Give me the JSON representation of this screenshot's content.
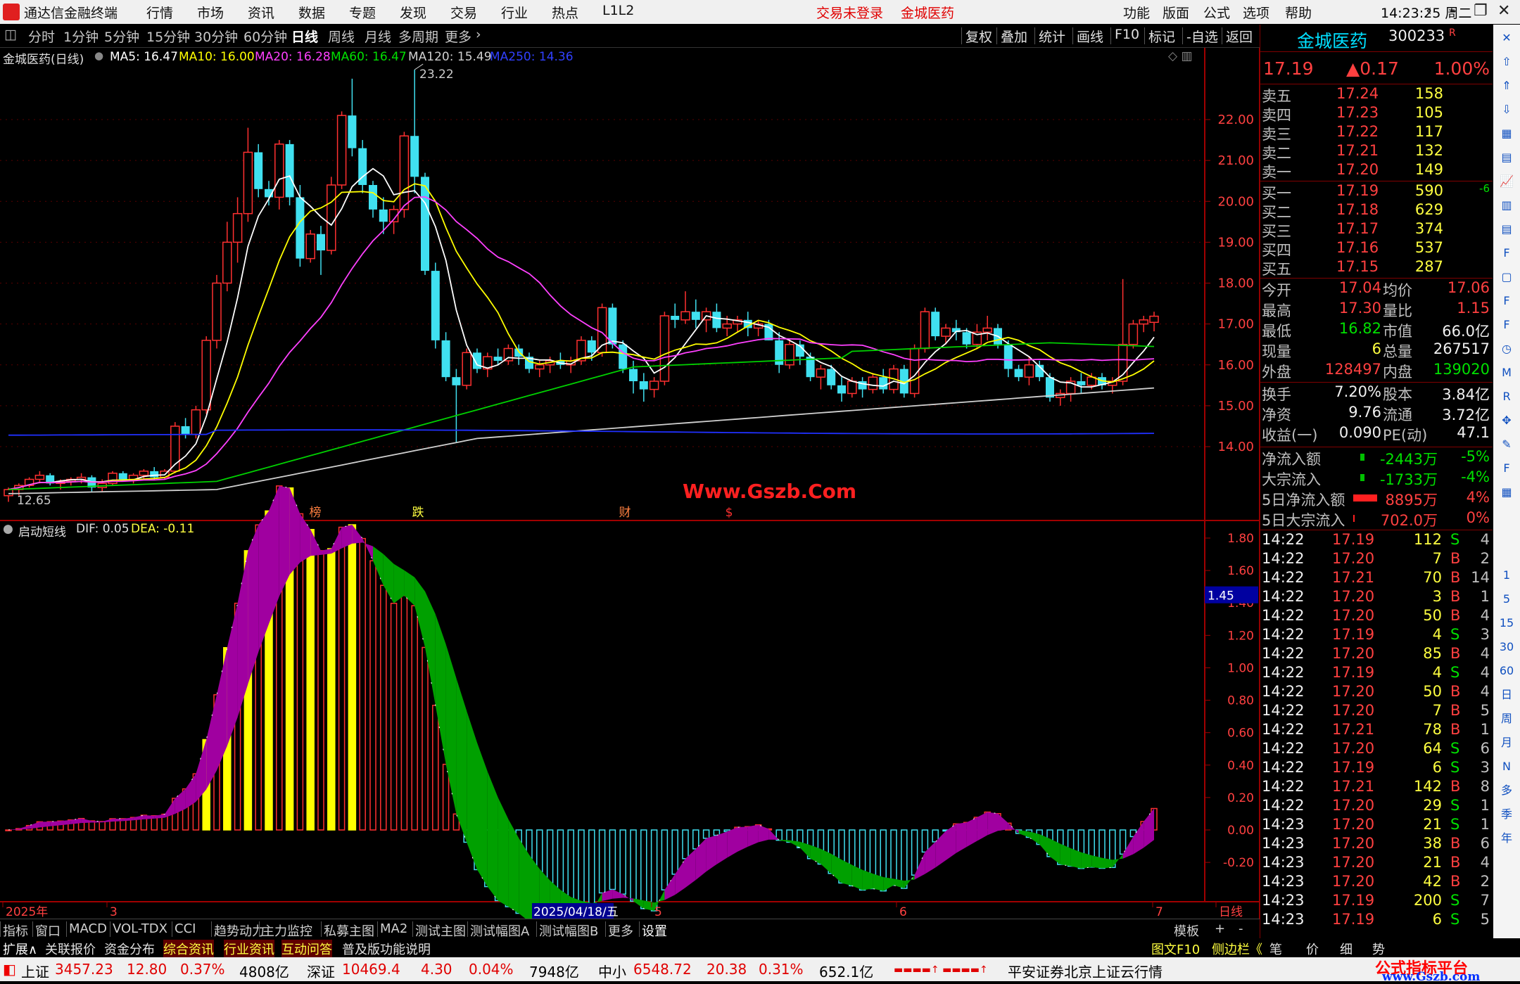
{
  "app": {
    "title": "通达信金融终端",
    "trade_status": "交易未登录",
    "stock_tab": "金城医药",
    "time": "14:23:25",
    "weekday": "周二"
  },
  "menu": [
    "行情",
    "市场",
    "资讯",
    "数据",
    "专题",
    "发现",
    "交易",
    "行业",
    "热点",
    "L1L2"
  ],
  "right_menu": [
    "功能",
    "版面",
    "公式",
    "选项",
    "帮助"
  ],
  "period_tabs": [
    "分时",
    "1分钟",
    "5分钟",
    "15分钟",
    "30分钟",
    "60分钟",
    "日线",
    "周线",
    "月线",
    "多周期",
    "更多"
  ],
  "active_period": "日线",
  "right_tools": [
    "复权",
    "叠加",
    "统计",
    "画线",
    "F10",
    "标记",
    "-自选",
    "返回"
  ],
  "main_header": {
    "name": "金城医药(日线)",
    "ma": [
      {
        "label": "MA5: 16.47",
        "color": "#ffffff"
      },
      {
        "label": "MA10: 16.00",
        "color": "#ffff00"
      },
      {
        "label": "MA20: 16.28",
        "color": "#ff40ff"
      },
      {
        "label": "MA60: 16.47",
        "color": "#00e000"
      },
      {
        "label": "MA120: 15.49",
        "color": "#d0d0d0"
      },
      {
        "label": "MA250: 14.36",
        "color": "#3040ff"
      }
    ],
    "high_mark": "23.22",
    "low_mark": "12.65",
    "watermark": "Www.Gszb.Com",
    "events": [
      "榜",
      "跌",
      "财",
      "$"
    ]
  },
  "price_axis": [
    "22.00",
    "21.00",
    "20.00",
    "19.00",
    "18.00",
    "17.00",
    "16.00",
    "15.00",
    "14.00"
  ],
  "sub_header": {
    "name": "启动短线",
    "dif": "DIF: 0.05",
    "dea": "DEA: -0.11"
  },
  "sub_axis": [
    "1.80",
    "1.60",
    "1.40",
    "1.20",
    "1.00",
    "0.80",
    "0.60",
    "0.40",
    "0.20",
    "0.00",
    "-0.20"
  ],
  "sub_marker": "1.45",
  "date_axis": {
    "year": "2025年",
    "m3": "3",
    "date_highlight": "2025/04/18/五",
    "m5": "5",
    "m6": "6",
    "m7": "7",
    "period": "日线"
  },
  "quote": {
    "name": "金城医药",
    "code": "300233",
    "flag": "R",
    "price": "17.19",
    "change": "▲0.17",
    "pct": "1.00%",
    "asks": [
      {
        "label": "卖五",
        "price": "17.24",
        "vol": "158"
      },
      {
        "label": "卖四",
        "price": "17.23",
        "vol": "105"
      },
      {
        "label": "卖三",
        "price": "17.22",
        "vol": "117"
      },
      {
        "label": "卖二",
        "price": "17.21",
        "vol": "132"
      },
      {
        "label": "卖一",
        "price": "17.20",
        "vol": "149"
      }
    ],
    "bids": [
      {
        "label": "买一",
        "price": "17.19",
        "vol": "590",
        "extra": "-6"
      },
      {
        "label": "买二",
        "price": "17.18",
        "vol": "629",
        "extra": ""
      },
      {
        "label": "买三",
        "price": "17.17",
        "vol": "374",
        "extra": ""
      },
      {
        "label": "买四",
        "price": "17.16",
        "vol": "537",
        "extra": ""
      },
      {
        "label": "买五",
        "price": "17.15",
        "vol": "287",
        "extra": ""
      }
    ],
    "stats": [
      {
        "l1": "今开",
        "v1": "17.04",
        "c1": "red",
        "l2": "均价",
        "v2": "17.06",
        "c2": "red"
      },
      {
        "l1": "最高",
        "v1": "17.30",
        "c1": "red",
        "l2": "量比",
        "v2": "1.15",
        "c2": "red"
      },
      {
        "l1": "最低",
        "v1": "16.82",
        "c1": "green",
        "l2": "市值",
        "v2": "66.0亿",
        "c2": "white"
      },
      {
        "l1": "现量",
        "v1": "6",
        "c1": "yellow",
        "l2": "总量",
        "v2": "267517",
        "c2": "white"
      },
      {
        "l1": "外盘",
        "v1": "128497",
        "c1": "red",
        "l2": "内盘",
        "v2": "139020",
        "c2": "green"
      }
    ],
    "stats2": [
      {
        "l1": "换手",
        "v1": "7.20%",
        "l2": "股本",
        "v2": "3.84亿"
      },
      {
        "l1": "净资",
        "v1": "9.76",
        "l2": "流通",
        "v2": "3.72亿"
      },
      {
        "l1": "收益(一)",
        "v1": "0.090",
        "l2": "PE(动)",
        "v2": "47.1"
      }
    ],
    "flows": [
      {
        "label": "净流入额",
        "value": "-2443万",
        "pct": "-5%",
        "color": "green"
      },
      {
        "label": "大宗流入",
        "value": "-1733万",
        "pct": "-4%",
        "color": "green"
      },
      {
        "label": "5日净流入额",
        "value": "8895万",
        "pct": "4%",
        "color": "red"
      },
      {
        "label": "5日大宗流入",
        "value": "702.0万",
        "pct": "0%",
        "color": "red"
      }
    ],
    "ticks": [
      [
        "14:22",
        "17.19",
        "112",
        "S",
        "4"
      ],
      [
        "14:22",
        "17.20",
        "7",
        "B",
        "2"
      ],
      [
        "14:22",
        "17.21",
        "70",
        "B",
        "14"
      ],
      [
        "14:22",
        "17.20",
        "3",
        "B",
        "1"
      ],
      [
        "14:22",
        "17.20",
        "50",
        "B",
        "4"
      ],
      [
        "14:22",
        "17.19",
        "4",
        "S",
        "3"
      ],
      [
        "14:22",
        "17.20",
        "85",
        "B",
        "4"
      ],
      [
        "14:22",
        "17.19",
        "4",
        "S",
        "4"
      ],
      [
        "14:22",
        "17.20",
        "50",
        "B",
        "4"
      ],
      [
        "14:22",
        "17.20",
        "7",
        "B",
        "5"
      ],
      [
        "14:22",
        "17.21",
        "78",
        "B",
        "1"
      ],
      [
        "14:22",
        "17.20",
        "64",
        "S",
        "6"
      ],
      [
        "14:22",
        "17.19",
        "6",
        "S",
        "3"
      ],
      [
        "14:22",
        "17.21",
        "142",
        "B",
        "8"
      ],
      [
        "14:22",
        "17.20",
        "29",
        "S",
        "1"
      ],
      [
        "14:23",
        "17.20",
        "21",
        "S",
        "1"
      ],
      [
        "14:23",
        "17.20",
        "38",
        "B",
        "6"
      ],
      [
        "14:23",
        "17.20",
        "21",
        "B",
        "4"
      ],
      [
        "14:23",
        "17.20",
        "42",
        "B",
        "2"
      ],
      [
        "14:23",
        "17.19",
        "200",
        "S",
        "7"
      ],
      [
        "14:23",
        "17.19",
        "6",
        "S",
        "5"
      ]
    ]
  },
  "bottom_tabs": [
    "指标",
    "窗口",
    "MACD",
    "VOL-TDX",
    "CCI",
    "趋势动力",
    "主力监控",
    "私募主图",
    "MA2",
    "测试主图",
    "测试幅图A",
    "测试幅图B",
    "更多",
    "设置"
  ],
  "bottom_right": [
    "模板",
    "+",
    "-"
  ],
  "bottom_tabs2": [
    "扩展∧",
    "关联报价",
    "资金分布",
    "综合资讯",
    "行业资讯",
    "互动问答",
    "普及版功能说明"
  ],
  "bottom_tabs2_right": [
    "图文F10",
    "侧边栏《",
    "笔",
    "价",
    "细",
    "势"
  ],
  "status": {
    "sh_label": "上证",
    "sh": "3457.23",
    "sh_chg": "12.80",
    "sh_pct": "0.37%",
    "sh_amt": "4808亿",
    "sz_label": "深证",
    "sz": "10469.4",
    "sz_chg": "4.30",
    "sz_pct": "0.04%",
    "sz_amt": "7948亿",
    "zx_label": "中小",
    "zx": "6548.72",
    "zx_chg": "20.38",
    "zx_pct": "0.31%",
    "zx_amt": "652.1亿",
    "server": "平安证券北京上证云行情",
    "brand1": "公式指标平台",
    "brand2": "www.Gszb.com"
  },
  "side_icons": [
    "close-icon",
    "up-icon",
    "up2-icon",
    "down-icon",
    "grid-icon",
    "table-icon",
    "chart-icon",
    "candle-icon",
    "list-icon",
    "f10-icon",
    "doc-icon",
    "f2-icon",
    "f-icon",
    "clock-icon",
    "macd-icon",
    "rsi-icon",
    "move-icon",
    "pen-icon",
    "fs-icon",
    "calc-icon"
  ],
  "side_labels": [
    "1",
    "5",
    "15",
    "30",
    "60",
    "日",
    "周",
    "月",
    "N",
    "多",
    "季",
    "年"
  ],
  "chart_data": {
    "type": "candlestick",
    "candles": [
      [
        12.8,
        13.0,
        12.65,
        12.95
      ],
      [
        12.95,
        13.1,
        12.8,
        13.05
      ],
      [
        13.05,
        13.25,
        13.0,
        13.2
      ],
      [
        13.2,
        13.4,
        13.1,
        13.3
      ],
      [
        13.3,
        13.35,
        13.05,
        13.1
      ],
      [
        13.1,
        13.2,
        12.95,
        13.15
      ],
      [
        13.15,
        13.25,
        13.05,
        13.2
      ],
      [
        13.2,
        13.35,
        13.1,
        13.25
      ],
      [
        13.25,
        13.3,
        12.9,
        13.0
      ],
      [
        13.0,
        13.2,
        12.9,
        13.1
      ],
      [
        13.1,
        13.4,
        13.05,
        13.35
      ],
      [
        13.35,
        13.4,
        13.15,
        13.2
      ],
      [
        13.2,
        13.35,
        13.1,
        13.3
      ],
      [
        13.3,
        13.45,
        13.2,
        13.4
      ],
      [
        13.4,
        13.5,
        13.2,
        13.25
      ],
      [
        13.25,
        13.45,
        13.2,
        13.4
      ],
      [
        13.4,
        14.6,
        13.35,
        14.5
      ],
      [
        14.5,
        14.7,
        14.2,
        14.3
      ],
      [
        14.3,
        15.0,
        14.2,
        14.9
      ],
      [
        14.9,
        16.7,
        14.8,
        16.6
      ],
      [
        16.6,
        18.2,
        16.4,
        18.0
      ],
      [
        18.0,
        19.5,
        17.8,
        19.0
      ],
      [
        19.0,
        20.1,
        18.5,
        19.7
      ],
      [
        19.7,
        21.8,
        19.5,
        21.2
      ],
      [
        21.2,
        21.4,
        20.1,
        20.3
      ],
      [
        20.3,
        20.5,
        19.9,
        20.1
      ],
      [
        20.1,
        21.5,
        19.8,
        21.4
      ],
      [
        21.4,
        21.5,
        19.9,
        20.1
      ],
      [
        20.1,
        20.4,
        18.4,
        18.6
      ],
      [
        18.6,
        19.3,
        18.5,
        19.2
      ],
      [
        19.2,
        19.4,
        18.2,
        18.8
      ],
      [
        18.8,
        20.6,
        18.7,
        20.4
      ],
      [
        20.4,
        22.2,
        20.3,
        22.1
      ],
      [
        22.1,
        23.0,
        21.1,
        21.3
      ],
      [
        21.3,
        21.5,
        20.2,
        20.4
      ],
      [
        20.4,
        20.5,
        19.6,
        19.8
      ],
      [
        19.8,
        20.1,
        19.2,
        19.5
      ],
      [
        19.5,
        19.9,
        19.2,
        19.8
      ],
      [
        19.8,
        21.7,
        19.6,
        21.6
      ],
      [
        21.6,
        23.22,
        20.2,
        20.6
      ],
      [
        20.6,
        20.7,
        18.2,
        18.3
      ],
      [
        18.3,
        18.5,
        16.4,
        16.6
      ],
      [
        16.6,
        16.8,
        15.6,
        15.7
      ],
      [
        15.7,
        15.9,
        14.1,
        15.5
      ],
      [
        15.5,
        16.4,
        15.4,
        16.3
      ],
      [
        16.3,
        16.4,
        15.8,
        15.9
      ],
      [
        15.9,
        16.3,
        15.7,
        16.2
      ],
      [
        16.2,
        16.4,
        16.0,
        16.1
      ],
      [
        16.1,
        16.5,
        16.0,
        16.4
      ],
      [
        16.4,
        16.5,
        16.0,
        16.2
      ],
      [
        16.2,
        16.3,
        15.8,
        15.9
      ],
      [
        15.9,
        16.1,
        15.7,
        16.0
      ],
      [
        16.0,
        16.2,
        15.8,
        16.1
      ],
      [
        16.1,
        16.3,
        15.9,
        16.0
      ],
      [
        16.0,
        16.2,
        15.8,
        16.1
      ],
      [
        16.1,
        16.7,
        16.0,
        16.6
      ],
      [
        16.6,
        16.7,
        16.1,
        16.3
      ],
      [
        16.3,
        17.5,
        16.2,
        17.4
      ],
      [
        17.4,
        17.5,
        16.4,
        16.5
      ],
      [
        16.5,
        16.6,
        15.8,
        15.9
      ],
      [
        15.9,
        16.1,
        15.3,
        15.6
      ],
      [
        15.6,
        15.8,
        15.1,
        15.4
      ],
      [
        15.4,
        15.7,
        15.2,
        15.6
      ],
      [
        15.6,
        17.3,
        15.5,
        17.2
      ],
      [
        17.2,
        17.5,
        16.9,
        17.1
      ],
      [
        17.1,
        17.8,
        17.0,
        17.3
      ],
      [
        17.3,
        17.6,
        16.9,
        17.1
      ],
      [
        17.1,
        17.4,
        16.8,
        17.3
      ],
      [
        17.3,
        17.5,
        16.8,
        16.9
      ],
      [
        16.9,
        17.2,
        16.7,
        17.0
      ],
      [
        17.0,
        17.2,
        16.8,
        17.1
      ],
      [
        17.1,
        17.3,
        16.7,
        16.9
      ],
      [
        16.9,
        17.1,
        16.7,
        17.0
      ],
      [
        17.0,
        17.1,
        16.6,
        16.6
      ],
      [
        16.6,
        16.8,
        15.8,
        16.0
      ],
      [
        16.0,
        16.6,
        15.9,
        16.5
      ],
      [
        16.5,
        16.6,
        16.0,
        16.2
      ],
      [
        16.2,
        16.3,
        15.6,
        15.7
      ],
      [
        15.7,
        16.0,
        15.4,
        15.9
      ],
      [
        15.9,
        16.0,
        15.4,
        15.5
      ],
      [
        15.5,
        15.7,
        15.1,
        15.3
      ],
      [
        15.3,
        15.7,
        15.2,
        15.6
      ],
      [
        15.6,
        15.7,
        15.2,
        15.4
      ],
      [
        15.4,
        15.8,
        15.3,
        15.7
      ],
      [
        15.7,
        15.9,
        15.3,
        15.4
      ],
      [
        15.4,
        16.0,
        15.3,
        15.9
      ],
      [
        15.9,
        16.0,
        15.2,
        15.3
      ],
      [
        15.3,
        16.5,
        15.2,
        16.4
      ],
      [
        16.4,
        17.4,
        16.3,
        17.3
      ],
      [
        17.3,
        17.4,
        16.6,
        16.7
      ],
      [
        16.7,
        17.0,
        16.5,
        16.9
      ],
      [
        16.9,
        17.1,
        16.6,
        16.8
      ],
      [
        16.8,
        16.9,
        16.4,
        16.5
      ],
      [
        16.5,
        17.0,
        16.4,
        16.8
      ],
      [
        16.8,
        17.2,
        16.6,
        16.9
      ],
      [
        16.9,
        17.0,
        16.4,
        16.5
      ],
      [
        16.5,
        16.6,
        15.7,
        15.9
      ],
      [
        15.9,
        16.0,
        15.6,
        15.7
      ],
      [
        15.7,
        16.2,
        15.5,
        16.0
      ],
      [
        16.0,
        16.1,
        15.6,
        15.7
      ],
      [
        15.7,
        15.8,
        15.1,
        15.2
      ],
      [
        15.2,
        15.4,
        15.0,
        15.3
      ],
      [
        15.3,
        15.7,
        15.1,
        15.6
      ],
      [
        15.6,
        15.8,
        15.3,
        15.5
      ],
      [
        15.5,
        15.8,
        15.4,
        15.7
      ],
      [
        15.7,
        15.8,
        15.4,
        15.5
      ],
      [
        15.5,
        15.7,
        15.3,
        15.6
      ],
      [
        15.6,
        18.1,
        15.5,
        16.5
      ],
      [
        16.5,
        17.1,
        16.4,
        17.0
      ],
      [
        17.0,
        17.2,
        16.8,
        17.1
      ],
      [
        17.04,
        17.3,
        16.82,
        17.19
      ]
    ]
  }
}
